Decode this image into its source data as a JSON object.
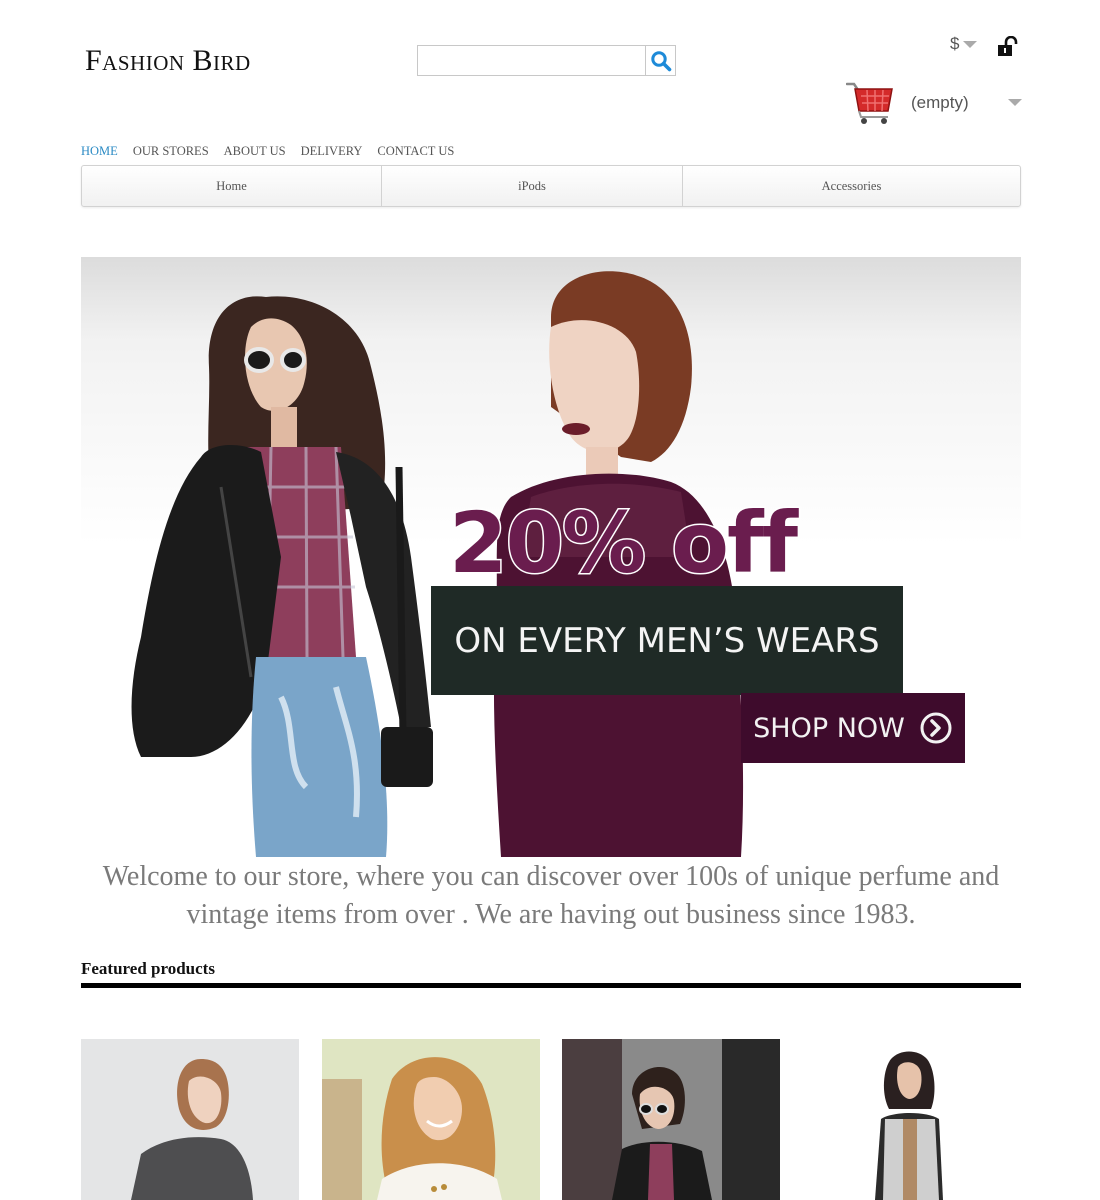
{
  "header": {
    "logo_text": "Fashion Bird",
    "currency_symbol": "$",
    "cart_label": "(empty)"
  },
  "top_nav": [
    "HOME",
    "OUR STORES",
    "ABOUT US",
    "DELIVERY",
    "CONTACT US"
  ],
  "menu": [
    "Home",
    "iPods",
    "Accessories"
  ],
  "banner": {
    "headline": "20% off",
    "subline": "ON EVERY MEN’S WEARS",
    "cta": "SHOP NOW"
  },
  "welcome_text": "Welcome to our store, where you can discover over 100s of unique perfume and vintage items from over . We are having out business since 1983.",
  "featured": {
    "title": "Featured products"
  },
  "colors": {
    "accent_link": "#2a8ac4",
    "promo_purple": "#6a1d4e",
    "promo_strip": "#1f2a26",
    "cta_background": "#3e0b2c",
    "cart_red": "#d42a2a"
  }
}
